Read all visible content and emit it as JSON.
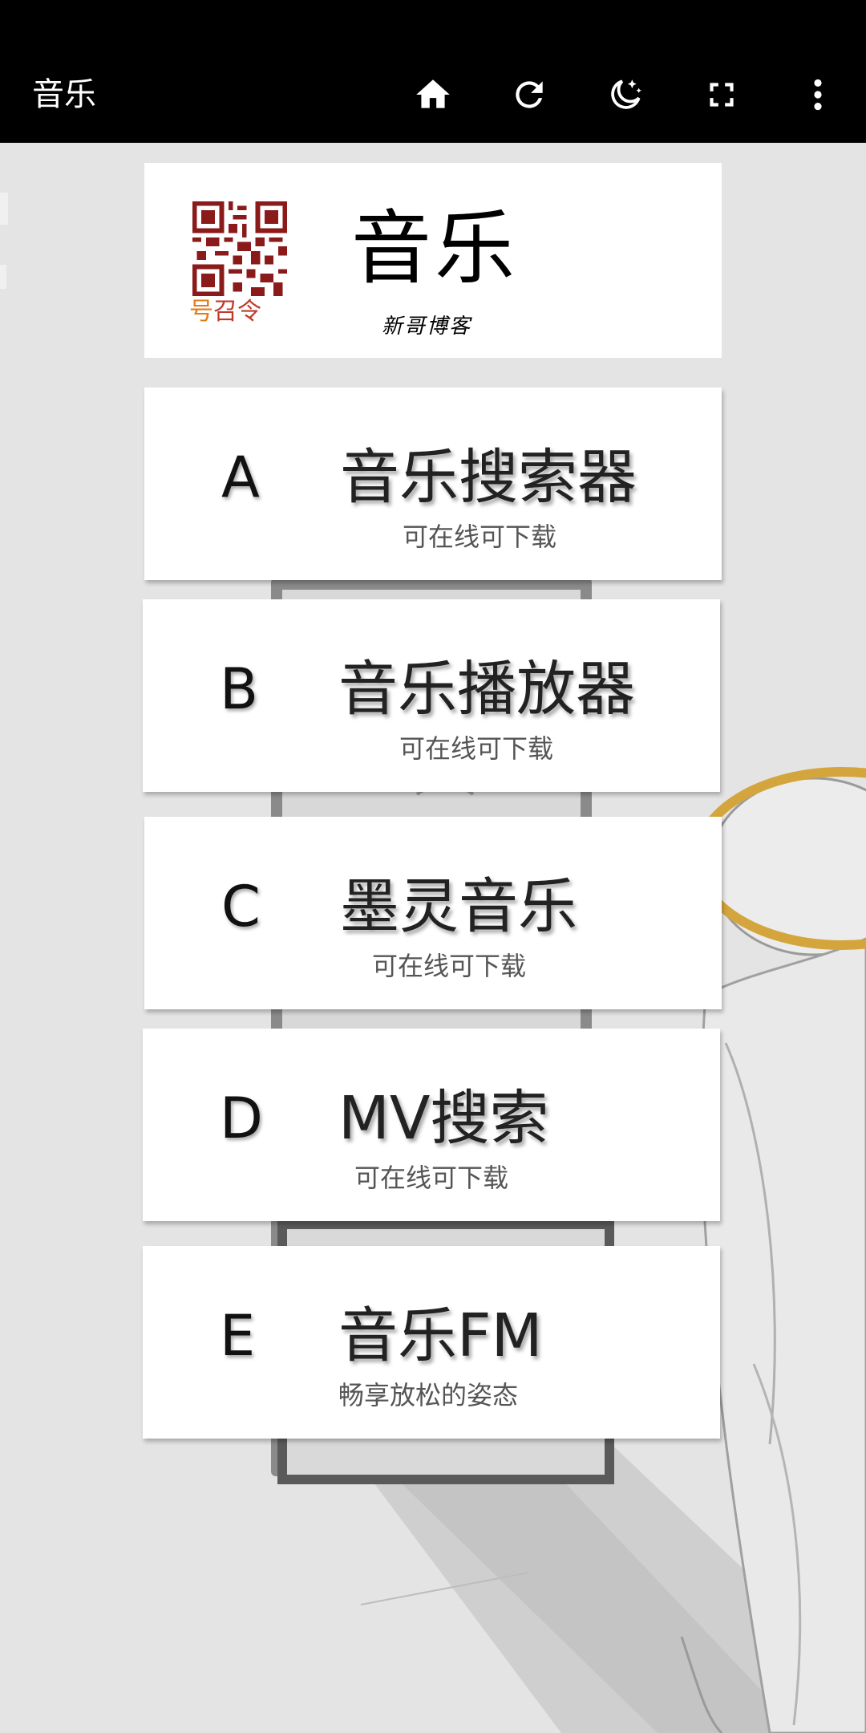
{
  "toolbar": {
    "title": "音乐",
    "icons": [
      "home-icon",
      "refresh-icon",
      "night-mode-icon",
      "fullscreen-icon",
      "more-vert-icon"
    ]
  },
  "header": {
    "qr_caption_1": "号",
    "qr_caption_2": "召令",
    "title": "音乐",
    "subtitle": "新哥博客"
  },
  "menu": [
    {
      "letter": "A",
      "title": "音乐搜索器",
      "subtitle": "可在线可下载"
    },
    {
      "letter": "B",
      "title": "音乐播放器",
      "subtitle": "可在线可下载"
    },
    {
      "letter": "C",
      "title": "墨灵音乐",
      "subtitle": "可在线可下载"
    },
    {
      "letter": "D",
      "title": "MV搜索",
      "subtitle": "可在线可下载"
    },
    {
      "letter": "E",
      "title": "音乐FM",
      "subtitle": "畅享放松的姿态"
    }
  ],
  "colors": {
    "toolbar_bg": "#000000",
    "page_bg": "#e4e4e4",
    "card_bg": "#ffffff",
    "halo": "#d4a53c"
  }
}
